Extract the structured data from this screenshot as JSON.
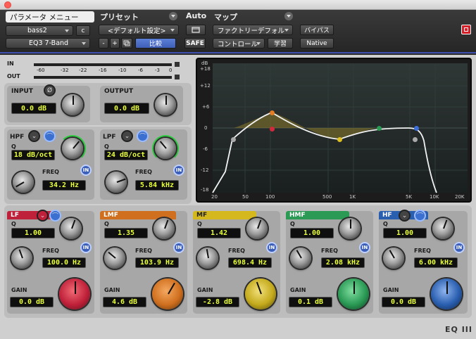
{
  "header": {
    "param_menu": "パラメータ メニュー",
    "preset": "プリセット",
    "auto": "Auto",
    "map": "マップ",
    "track": "bass2",
    "track_channel": "c",
    "plugin": "EQ3 7-Band",
    "preset_name": "<デフォルト設定>",
    "minus": "-",
    "plus": "+",
    "compare": "比較",
    "safe": "SAFE",
    "factory_default": "ファクトリーデフォル",
    "control": "コントロール",
    "learn": "学習",
    "bypass": "バイパス",
    "native": "Native"
  },
  "meters": {
    "in_label": "IN",
    "out_label": "OUT",
    "ticks": [
      "-60",
      "-32",
      "-22",
      "-16",
      "-10",
      "-6",
      "-3",
      "0"
    ]
  },
  "input": {
    "label": "INPUT",
    "value": "0.0 dB"
  },
  "output": {
    "label": "OUTPUT",
    "value": "0.0 dB"
  },
  "hpf": {
    "label": "HPF",
    "q_label": "Q",
    "q_value": "18 dB/oct",
    "freq_label": "FREQ",
    "freq_value": "34.2 Hz",
    "in": "IN"
  },
  "lpf": {
    "label": "LPF",
    "q_label": "Q",
    "q_value": "24 dB/oct",
    "freq_label": "FREQ",
    "freq_value": "5.84 kHz",
    "in": "IN"
  },
  "graph": {
    "db_labels": [
      "dB",
      "+18",
      "+12",
      "+6",
      "0",
      "-6",
      "-12",
      "-18"
    ],
    "freq_labels": [
      "20",
      "50",
      "100",
      "500",
      "1K",
      "5K",
      "10K",
      "20K"
    ]
  },
  "bands": [
    {
      "key": "lf",
      "label": "LF",
      "color": "#c0213a",
      "q_label": "Q",
      "q_value": "1.00",
      "freq_label": "FREQ",
      "freq_value": "100.0 Hz",
      "gain_label": "GAIN",
      "gain_value": "0.0 dB",
      "in": "IN"
    },
    {
      "key": "lmf",
      "label": "LMF",
      "color": "#d0701f",
      "q_label": "Q",
      "q_value": "1.35",
      "freq_label": "FREQ",
      "freq_value": "103.9 Hz",
      "gain_label": "GAIN",
      "gain_value": "4.6 dB",
      "in": "IN"
    },
    {
      "key": "mf",
      "label": "MF",
      "color": "#d4b81e",
      "q_label": "Q",
      "q_value": "1.42",
      "freq_label": "FREQ",
      "freq_value": "698.4 Hz",
      "gain_label": "GAIN",
      "gain_value": "-2.8 dB",
      "in": "IN"
    },
    {
      "key": "hmf",
      "label": "HMF",
      "color": "#2a9a55",
      "q_label": "Q",
      "q_value": "1.00",
      "freq_label": "FREQ",
      "freq_value": "2.08 kHz",
      "gain_label": "GAIN",
      "gain_value": "0.1 dB",
      "in": "IN"
    },
    {
      "key": "hf",
      "label": "HF",
      "color": "#2a5fb0",
      "q_label": "Q",
      "q_value": "1.00",
      "freq_label": "FREQ",
      "freq_value": "6.00 kHz",
      "gain_label": "GAIN",
      "gain_value": "0.0 dB",
      "in": "IN"
    }
  ],
  "footer": {
    "logo": "EQ III"
  }
}
